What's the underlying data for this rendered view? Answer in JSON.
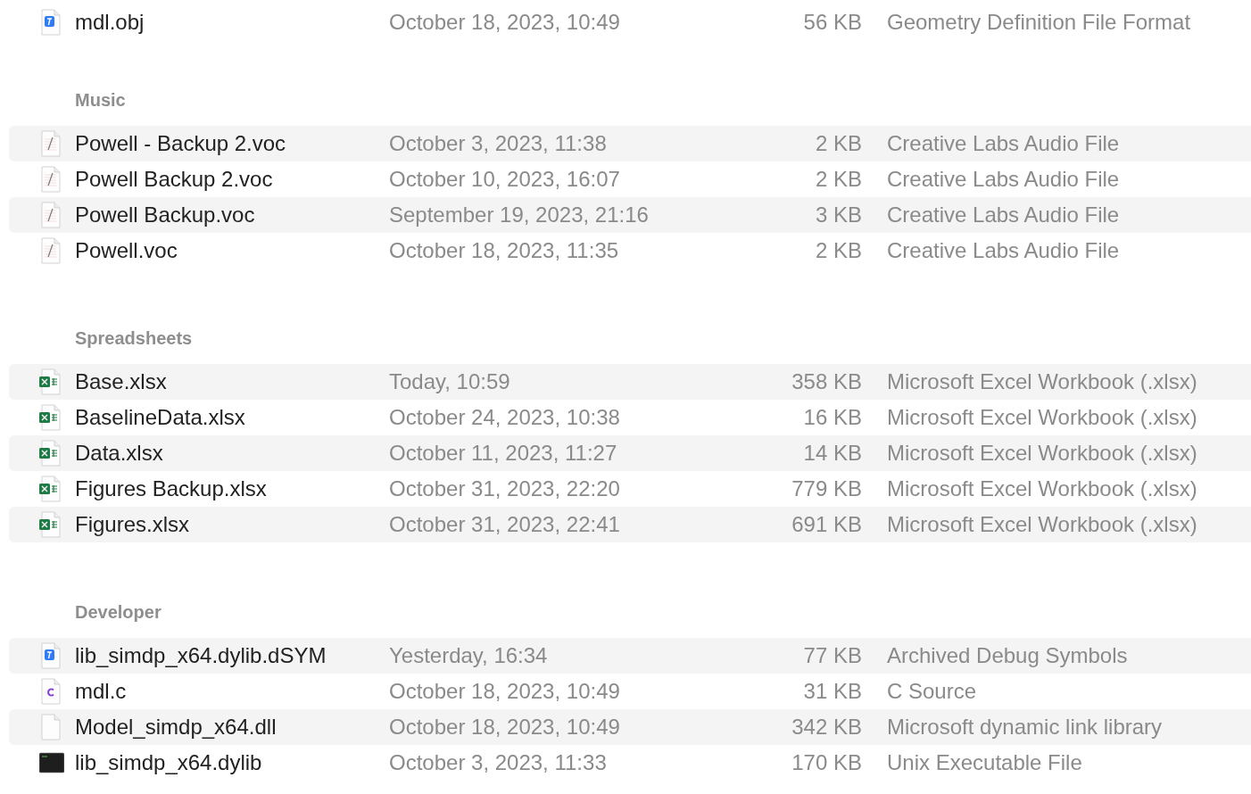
{
  "sections": [
    {
      "rows": [
        {
          "kind": "xcode",
          "name": "mdl.obj",
          "date": "October 18, 2023, 10:49",
          "size": "56 KB",
          "file_type": "Geometry Definition File Format"
        }
      ]
    },
    {
      "title": "Music",
      "rows": [
        {
          "kind": "text",
          "name": "Powell - Backup 2.voc",
          "date": "October 3, 2023, 11:38",
          "size": "2 KB",
          "file_type": "Creative Labs Audio File"
        },
        {
          "kind": "text",
          "name": "Powell Backup 2.voc",
          "date": "October 10, 2023, 16:07",
          "size": "2 KB",
          "file_type": "Creative Labs Audio File"
        },
        {
          "kind": "text",
          "name": "Powell Backup.voc",
          "date": "September 19, 2023, 21:16",
          "size": "3 KB",
          "file_type": "Creative Labs Audio File"
        },
        {
          "kind": "text",
          "name": "Powell.voc",
          "date": "October 18, 2023, 11:35",
          "size": "2 KB",
          "file_type": "Creative Labs Audio File"
        }
      ]
    },
    {
      "title": "Spreadsheets",
      "rows": [
        {
          "kind": "excel",
          "name": "Base.xlsx",
          "date": "Today, 10:59",
          "size": "358 KB",
          "file_type": "Microsoft Excel Workbook (.xlsx)"
        },
        {
          "kind": "excel",
          "name": "BaselineData.xlsx",
          "date": "October 24, 2023, 10:38",
          "size": "16 KB",
          "file_type": "Microsoft Excel Workbook (.xlsx)"
        },
        {
          "kind": "excel",
          "name": "Data.xlsx",
          "date": "October 11, 2023, 11:27",
          "size": "14 KB",
          "file_type": "Microsoft Excel Workbook (.xlsx)"
        },
        {
          "kind": "excel",
          "name": "Figures Backup.xlsx",
          "date": "October 31, 2023, 22:20",
          "size": "779 KB",
          "file_type": "Microsoft Excel Workbook (.xlsx)"
        },
        {
          "kind": "excel",
          "name": "Figures.xlsx",
          "date": "October 31, 2023, 22:41",
          "size": "691 KB",
          "file_type": "Microsoft Excel Workbook (.xlsx)"
        }
      ]
    },
    {
      "title": "Developer",
      "rows": [
        {
          "kind": "xcode",
          "name": "lib_simdp_x64.dylib.dSYM",
          "date": "Yesterday, 16:34",
          "size": "77 KB",
          "file_type": "Archived Debug Symbols"
        },
        {
          "kind": "csource",
          "name": "mdl.c",
          "date": "October 18, 2023, 10:49",
          "size": "31 KB",
          "file_type": "C Source"
        },
        {
          "kind": "blank",
          "name": "Model_simdp_x64.dll",
          "date": "October 18, 2023, 10:49",
          "size": "342 KB",
          "file_type": "Microsoft dynamic link library"
        },
        {
          "kind": "terminal",
          "name": "lib_simdp_x64.dylib",
          "date": "October 3, 2023, 11:33",
          "size": "170 KB",
          "file_type": "Unix Executable File"
        }
      ]
    }
  ]
}
